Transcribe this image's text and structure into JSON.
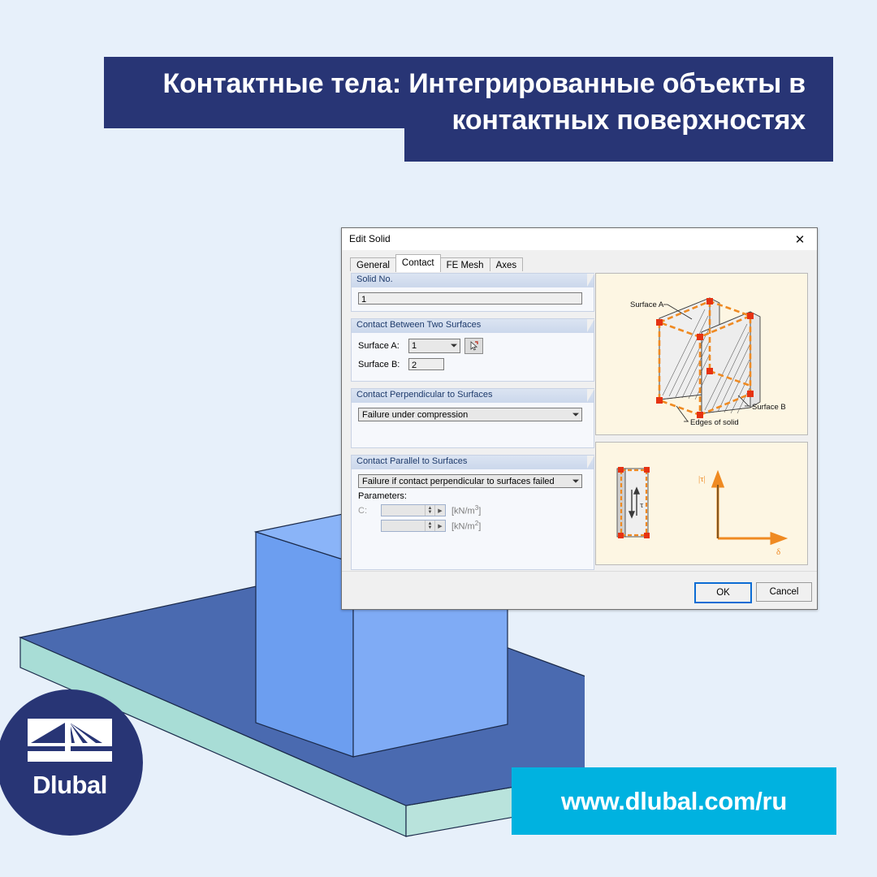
{
  "page": {
    "background_color": "#e7f0fa"
  },
  "title_banner": {
    "text": "Контактные тела: Интегрированные объекты в\nконтактных поверхностях",
    "background_color": "#283575",
    "text_color": "#ffffff"
  },
  "dialog": {
    "title": "Edit Solid",
    "close_icon": "close-icon",
    "tabs": [
      {
        "label": "General",
        "active": false
      },
      {
        "label": "Contact",
        "active": true
      },
      {
        "label": "FE Mesh",
        "active": false
      },
      {
        "label": "Axes",
        "active": false
      }
    ],
    "solid_no": {
      "group_label": "Solid No.",
      "value": "1"
    },
    "contact_between": {
      "group_label": "Contact Between Two Surfaces",
      "surface_a_label": "Surface A:",
      "surface_a_value": "1",
      "surface_a_pick_icon": "pick-cursor-icon",
      "surface_b_label": "Surface B:",
      "surface_b_value": "2"
    },
    "contact_perpendicular": {
      "group_label": "Contact Perpendicular to Surfaces",
      "value": "Failure under compression"
    },
    "contact_parallel": {
      "group_label": "Contact Parallel to Surfaces",
      "value": "Failure if contact perpendicular to surfaces failed",
      "parameters_label": "Parameters:",
      "params": [
        {
          "name": "C:",
          "value": "",
          "unit_prefix": "[kN/m",
          "unit_exp": "3",
          "unit_suffix": "]"
        },
        {
          "name": "",
          "value": "",
          "unit_prefix": "[kN/m",
          "unit_exp": "2",
          "unit_suffix": "]"
        }
      ]
    },
    "diagram_1": {
      "label_surface_a": "Surface A",
      "label_surface_b": "Surface B",
      "label_edges": "Edges of solid",
      "accent_color": "#ef8a22",
      "node_color": "#e63312"
    },
    "diagram_2": {
      "label_tau_element": "τ",
      "label_y_axis": "|τ|",
      "label_x_axis": "δ",
      "accent_color": "#ef8a22"
    },
    "buttons": {
      "ok": "OK",
      "cancel": "Cancel",
      "ok_focus_color": "#0b6cd4"
    }
  },
  "model": {
    "slab_top_color": "#4a6ab0",
    "slab_side_color": "#a8ddd6",
    "box_color": "#6c9ef0",
    "box_light_color": "#8ab4f8",
    "edge_color": "#1b2a4a"
  },
  "logo": {
    "brand": "Dlubal",
    "circle_color": "#283575",
    "mark_icon": "dlubal-bridge-mark-icon"
  },
  "url_banner": {
    "text": "www.dlubal.com/ru",
    "background_color": "#00b2e0",
    "text_color": "#ffffff"
  }
}
